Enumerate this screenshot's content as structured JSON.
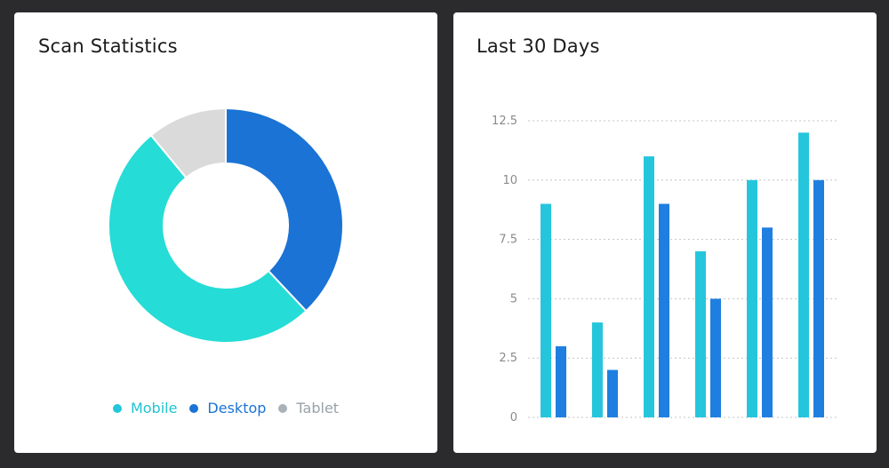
{
  "cards": {
    "scan": {
      "title": "Scan Statistics"
    },
    "trend": {
      "title": "Last 30 Days"
    }
  },
  "colors": {
    "mobile": "#25dcd6",
    "desktop": "#1a73d5",
    "tablet": "#dadada",
    "bar_light": "#25c6dc",
    "bar_dark": "#1f7fe0",
    "legend_tablet_text": "#98a2a8"
  },
  "chart_data": [
    {
      "type": "pie",
      "title": "Scan Statistics",
      "labels": [
        "Mobile",
        "Desktop",
        "Tablet"
      ],
      "values": [
        51,
        38,
        11
      ],
      "colors": [
        "#25dcd6",
        "#1a73d5",
        "#dadada"
      ],
      "legend_position": "bottom"
    },
    {
      "type": "bar",
      "title": "Last 30 Days",
      "categories": [
        "",
        "",
        "",
        "",
        "",
        ""
      ],
      "series": [
        {
          "values": [
            9,
            4,
            11,
            7,
            10,
            12
          ]
        },
        {
          "values": [
            3,
            2,
            9,
            5,
            8,
            10
          ]
        }
      ],
      "yticks": [
        "0",
        "2.5",
        "5",
        "7.5",
        "10",
        "12.5"
      ],
      "ytick_values": [
        0,
        2.5,
        5,
        7.5,
        10,
        12.5
      ],
      "ylim": [
        0,
        12.5
      ],
      "grid": true
    }
  ]
}
